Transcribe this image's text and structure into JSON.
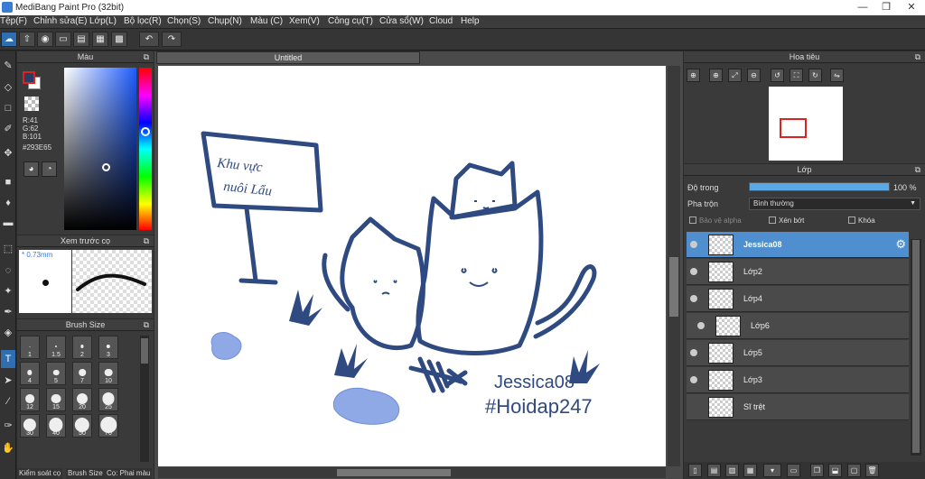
{
  "titlebar": {
    "title": "MediBang Paint Pro (32bit)",
    "minimize": "—",
    "restore": "❐",
    "close": "✕"
  },
  "menu": [
    "Tệp(F)",
    "Chỉnh sửa(E)",
    "Lớp(L)",
    "Bộ lọc(R)",
    "Chọn(S)",
    "Chụp(N)",
    "Màu (C)",
    "Xem(V)",
    "Công cụ(T)",
    "Cửa sổ(W)",
    "Cloud",
    "Help"
  ],
  "colorpanel": {
    "title": "Màu",
    "r": "R:41",
    "g": "G:62",
    "b": "B:101",
    "hex": "#293E65",
    "fg": "#293E65"
  },
  "brushpreview": {
    "title": "Xem trước cọ",
    "size": "* 0.73mm"
  },
  "brushsize": {
    "title": "Brush Size",
    "sizes": [
      "1",
      "1.5",
      "2",
      "3",
      "4",
      "5",
      "7",
      "10",
      "12",
      "15",
      "20",
      "25",
      "30",
      "40",
      "50",
      "70"
    ],
    "tabs": [
      "Kiểm soát cọ",
      "Brush Size",
      "Cọ: Phai màu"
    ]
  },
  "document": {
    "tab": "Untitled",
    "text_line1": "Jessica08",
    "text_line2": "#Hoidap247",
    "sign_text1": "Khu vực",
    "sign_text2": "nuôi Lẩu",
    "ink": "#2f4a80",
    "fill": "#8fa9e6"
  },
  "navigator": {
    "title": "Hoa tiêu"
  },
  "layers": {
    "title": "Lớp",
    "opacity_label": "Độ trong",
    "opacity_value": "100 %",
    "opacity": 1.0,
    "blend_label": "Pha trộn",
    "blend_value": "Bình thường",
    "protect_alpha": "Bảo vệ alpha",
    "clip": "Xén bớt",
    "lock": "Khóa",
    "items": [
      {
        "name": "Jessica08",
        "selected": true
      },
      {
        "name": "Lớp2"
      },
      {
        "name": "Lớp4"
      },
      {
        "name": "Lớp6"
      },
      {
        "name": "Lớp5"
      },
      {
        "name": "Lớp3"
      },
      {
        "name": "Sĩ trệt"
      }
    ]
  }
}
